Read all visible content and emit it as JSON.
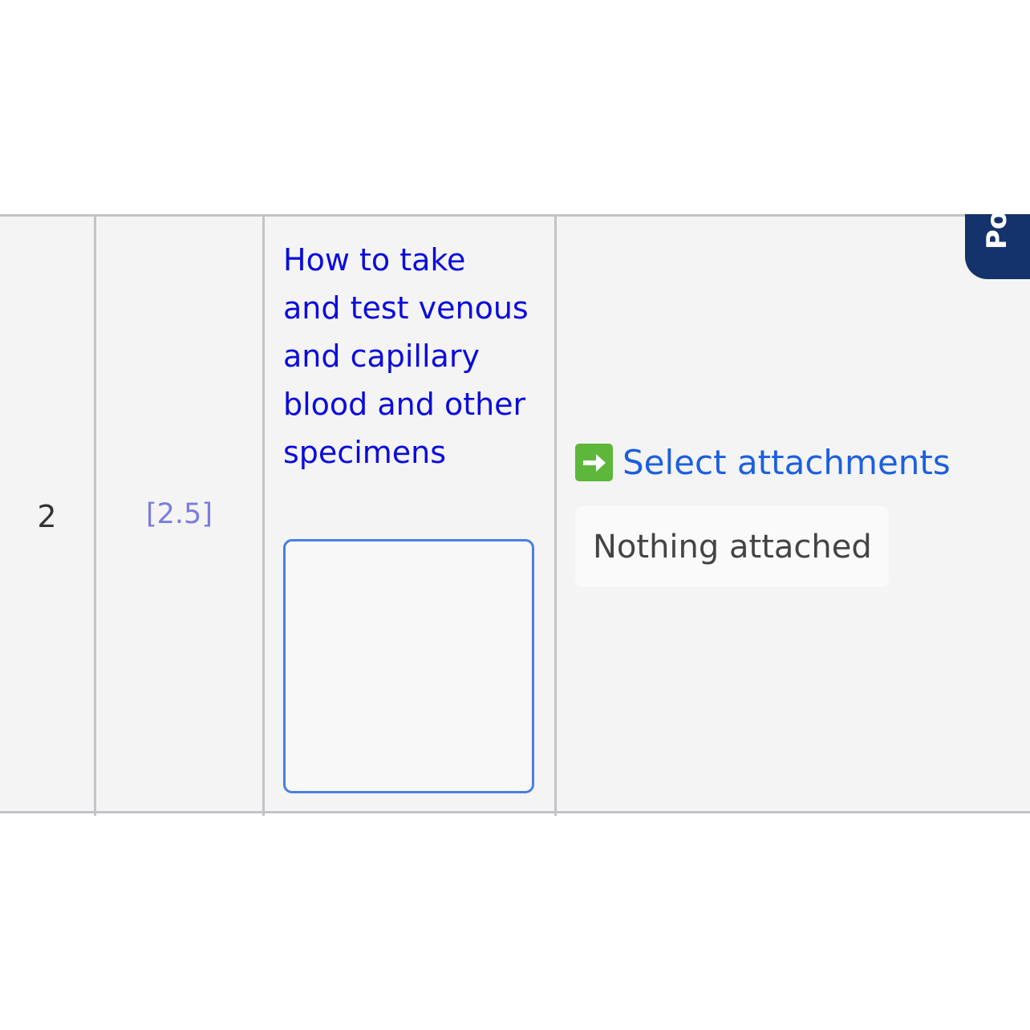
{
  "row": {
    "number": "2",
    "reference": "[2.5]",
    "criteria": "How to take and test venous and capillary blood and other specimens",
    "evidence_value": "",
    "select_attachments_label": "Select attachments",
    "attachments_status": "Nothing attached"
  },
  "side_tab": {
    "label": "Po"
  },
  "icons": {
    "select_attachments": "arrow-right-icon"
  },
  "colors": {
    "row_background": "#f4f4f4",
    "border": "#c3c3c8",
    "criteria_link": "#0b0bdc",
    "reference_link": "#7b7be0",
    "select_link": "#1c5fe0",
    "arrow_icon_bg": "#5cb73a",
    "input_border": "#4a7fe0",
    "side_tab_bg": "#14326b"
  }
}
